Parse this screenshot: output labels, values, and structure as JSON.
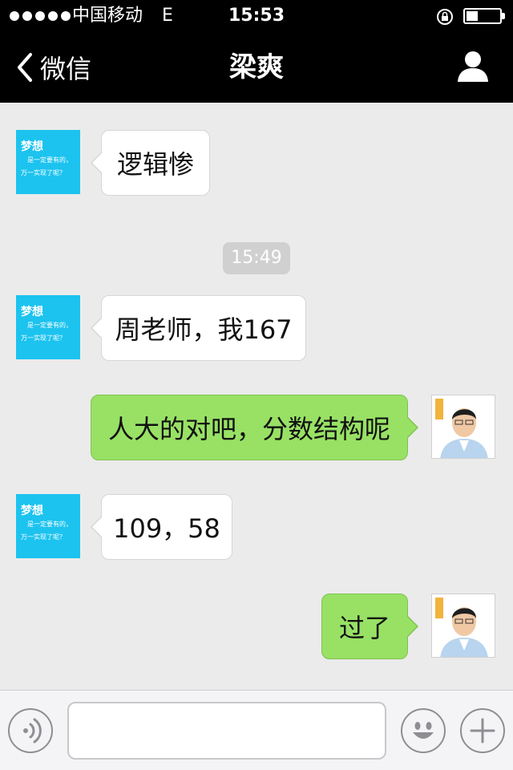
{
  "status_bar": {
    "carrier": "中国移动",
    "network": "E",
    "time": "15:53"
  },
  "nav": {
    "back_label": "微信",
    "title": "梁爽",
    "profile_icon": "person-icon"
  },
  "chat": {
    "contact_avatar": {
      "line1": "梦想",
      "line2": "是一定要有的，",
      "line3": "万一实现了呢？"
    },
    "timestamp": "15:49",
    "messages": [
      {
        "side": "incoming",
        "text": "逻辑惨"
      },
      {
        "side": "incoming",
        "text": "周老师，我167"
      },
      {
        "side": "outgoing",
        "text": "人大的对吧，分数结构呢"
      },
      {
        "side": "incoming",
        "text": "109，58"
      },
      {
        "side": "outgoing",
        "text": "过了"
      }
    ]
  },
  "input_bar": {
    "voice_icon": "voice-icon",
    "emoji_icon": "smiley-icon",
    "more_icon": "plus-icon",
    "text_value": ""
  },
  "colors": {
    "nav_background": "#000000",
    "chat_background": "#ebebeb",
    "outgoing_bubble": "#98e165",
    "incoming_bubble": "#ffffff",
    "contact_avatar_bg": "#1cc3ef"
  }
}
